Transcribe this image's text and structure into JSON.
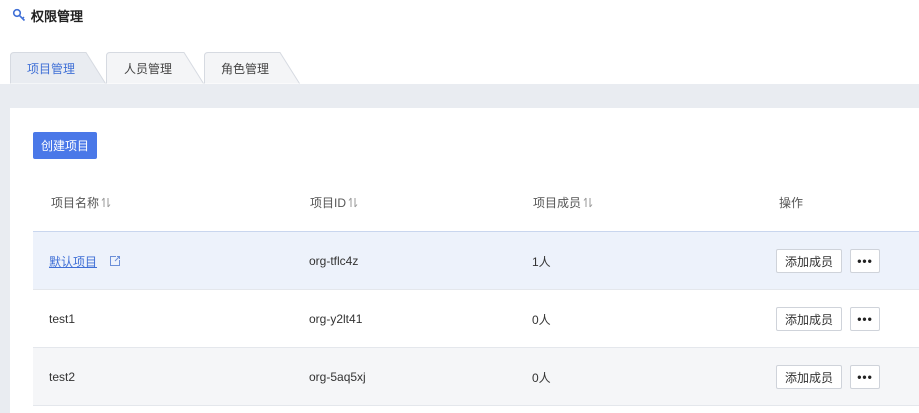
{
  "page": {
    "title": "权限管理",
    "icon": "key-icon"
  },
  "tabs": [
    {
      "label": "项目管理",
      "active": true
    },
    {
      "label": "人员管理",
      "active": false
    },
    {
      "label": "角色管理",
      "active": false
    }
  ],
  "toolbar": {
    "create_label": "创建项目"
  },
  "table": {
    "columns": [
      "项目名称",
      "项目ID",
      "项目成员",
      "操作"
    ],
    "rows": [
      {
        "name": "默认项目",
        "id": "org-tflc4z",
        "members": "1人",
        "add_label": "添加成员",
        "more_label": "•••"
      },
      {
        "name": "test1",
        "id": "org-y2lt41",
        "members": "0人",
        "add_label": "添加成员",
        "more_label": "•••"
      },
      {
        "name": "test2",
        "id": "org-5aq5xj",
        "members": "0人",
        "add_label": "添加成员",
        "more_label": "•••"
      }
    ]
  },
  "colors": {
    "accent": "#4a78e8",
    "link": "#3f6fd6",
    "background": "#e9ecf1",
    "highlight_row": "#edf2fb"
  }
}
